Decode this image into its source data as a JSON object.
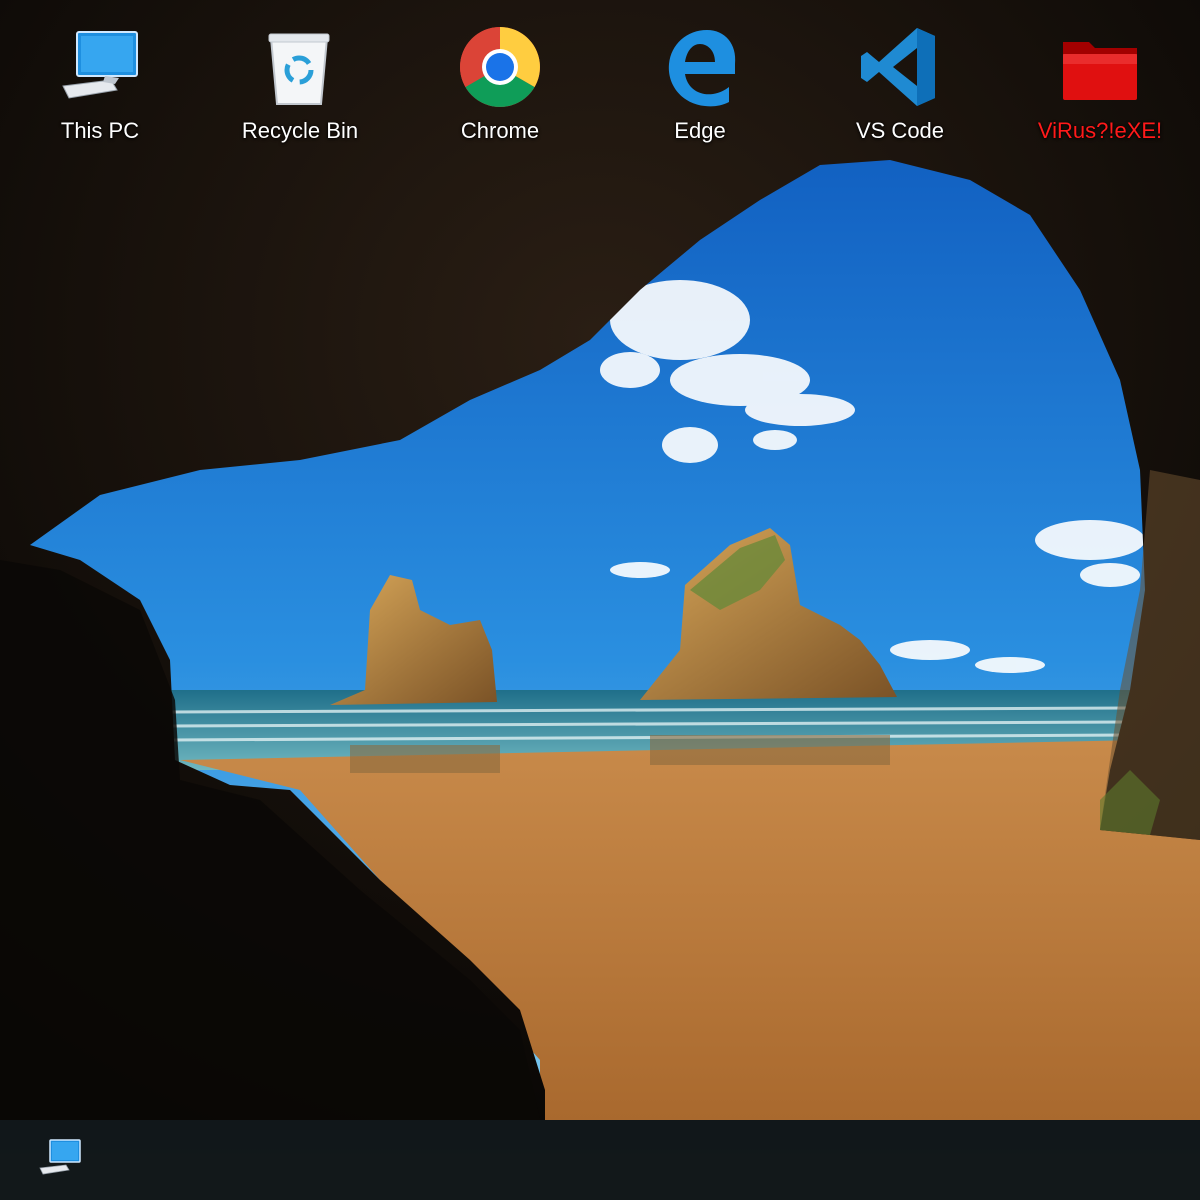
{
  "desktop": {
    "icons": [
      {
        "label": "This PC",
        "icon": "this-pc-icon"
      },
      {
        "label": "Recycle Bin",
        "icon": "recycle-bin-icon"
      },
      {
        "label": "Chrome",
        "icon": "chrome-icon"
      },
      {
        "label": "Edge",
        "icon": "edge-icon"
      },
      {
        "label": "VS Code",
        "icon": "vscode-icon"
      },
      {
        "label": "ViRus?!eXE!",
        "icon": "red-folder-icon"
      }
    ]
  },
  "taskbar": {
    "pinned": [
      {
        "icon": "this-pc-icon"
      }
    ]
  },
  "colors": {
    "label_text": "#ffffff",
    "danger_label_text": "#ff1a1a",
    "taskbar": "#080808",
    "accent_blue": "#1e8fe0"
  }
}
